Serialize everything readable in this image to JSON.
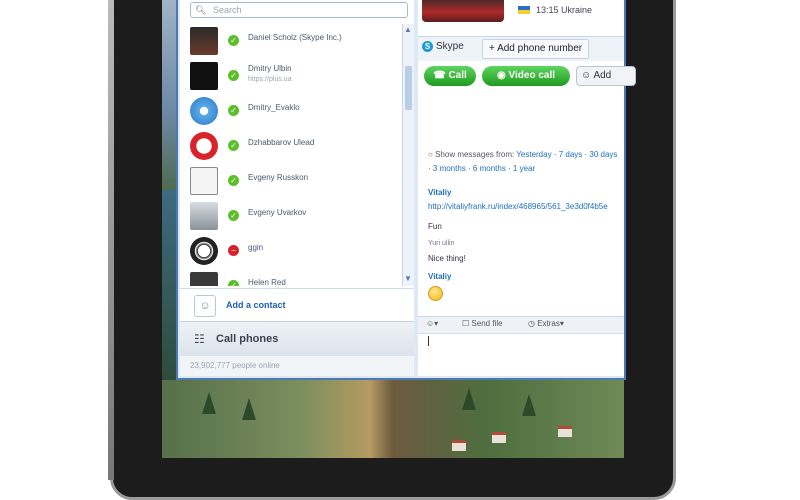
{
  "device": {
    "frame_color": "#1c1c1c"
  },
  "search": {
    "placeholder": "Search",
    "icon": "search-icon"
  },
  "contacts": [
    {
      "name": "Daniel Scholz (Skype Inc.)",
      "mood": "",
      "status": "online",
      "avatar": "portrait-photo"
    },
    {
      "name": "Dmitry Ulbin",
      "mood": "https://plus.ua",
      "status": "online",
      "avatar": "dark-figure"
    },
    {
      "name": "Dmitry_Evaklo",
      "mood": "",
      "status": "online",
      "avatar": "safari-compass-icon"
    },
    {
      "name": "Dzhabbarov Ulead",
      "mood": "",
      "status": "online",
      "avatar": "red-s-logo"
    },
    {
      "name": "Evgeny Russkon",
      "mood": "",
      "status": "online",
      "avatar": "sketch-figure"
    },
    {
      "name": "Evgeny Uvarkov",
      "mood": "",
      "status": "online",
      "avatar": "keyboard-photo"
    },
    {
      "name": "ggin",
      "mood": "",
      "status": "busy",
      "avatar": "soccer-ball"
    },
    {
      "name": "Helen Red",
      "mood": "",
      "status": "online",
      "avatar": "small-photo"
    }
  ],
  "add_contact": {
    "label": "Add a contact"
  },
  "call_phones": {
    "label": "Call phones"
  },
  "online_count": {
    "text": "23,902,777 people online"
  },
  "profile": {
    "time": "13:15 Ukraine",
    "flag": "ukraine-flag"
  },
  "conversation": {
    "tab_label": "Skype",
    "add_phone_label": "+ Add phone number",
    "call_label": "Call",
    "video_label": "Video call",
    "add_label": "Add",
    "history": {
      "prefix": "Show messages from:",
      "options": [
        "Yesterday",
        "7 days",
        "30 days",
        "3 months",
        "6 months",
        "1 year"
      ]
    },
    "messages": [
      {
        "sender": "Vitaliy",
        "link": "http://vitaliyfrank.ru/index/468965/561_3e3d0f4b5e",
        "text": "Fun"
      },
      {
        "sender": "Yuri ullin",
        "text": "Nice thing!"
      },
      {
        "sender": "Vitaliy",
        "emoticon": "smiley"
      }
    ],
    "compose": {
      "emoticon": "emoticon-icon",
      "send_file": "Send file",
      "extras": "Extras"
    }
  }
}
